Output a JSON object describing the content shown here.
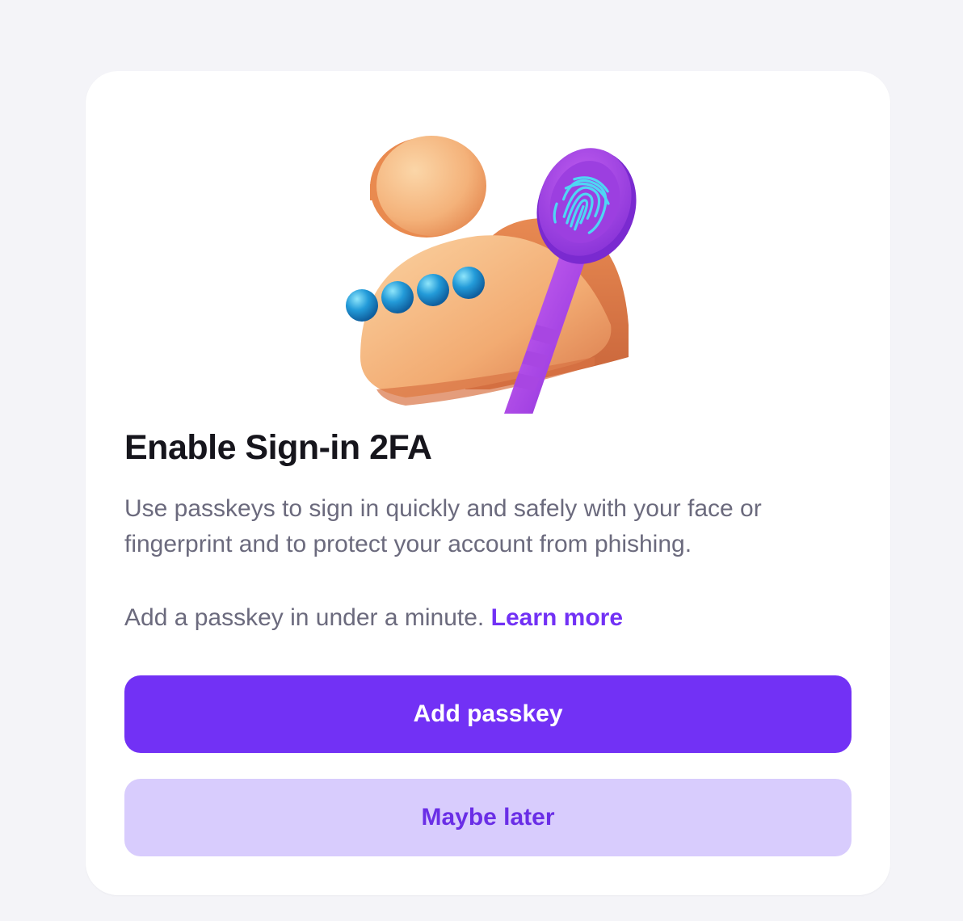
{
  "card": {
    "illustration": {
      "icon": "passkey-user-key-illustration",
      "colors": {
        "person": "#f4b87e",
        "key": "#b14ee6",
        "fingerprint": "#4fd6f4",
        "dots": "#1d8fd6"
      }
    },
    "title": "Enable Sign-in 2FA",
    "description": "Use passkeys to sign in quickly and safely with your face or fingerprint and to protect your account from phishing.",
    "hint": {
      "text": "Add a passkey in under a minute.",
      "link_label": "Learn more"
    },
    "primary_button": {
      "label": "Add passkey",
      "color": "#7231f5"
    },
    "secondary_button": {
      "label": "Maybe later",
      "color": "#d8ccfd"
    }
  }
}
